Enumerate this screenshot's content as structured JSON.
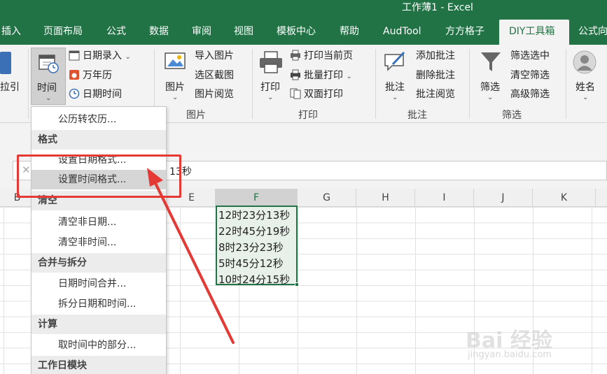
{
  "window": {
    "title": "工作薄1  -  Excel"
  },
  "tabs": [
    "插入",
    "页面布局",
    "公式",
    "数据",
    "审阅",
    "视图",
    "模板中心",
    "帮助",
    "AudTool",
    "方方格子",
    "DIY工具箱",
    "公式向"
  ],
  "ribbon": {
    "left_partial": "拉引",
    "time_button": "时间",
    "date_items": [
      "日期录入",
      "万年历",
      "日期时间"
    ],
    "picture_button": "图片",
    "picture_items": [
      "导入图片",
      "选区截图",
      "图片阅览"
    ],
    "picture_group": "图片",
    "print_button": "打印",
    "print_items": [
      "打印当前页",
      "批量打印",
      "双面打印"
    ],
    "print_group": "打印",
    "comment_button": "批注",
    "comment_items": [
      "添加批注",
      "删除批注",
      "批注阅览"
    ],
    "comment_group": "批注",
    "filter_button": "筛选",
    "filter_items": [
      "筛选选中",
      "清空筛选",
      "高级筛选"
    ],
    "filter_group": "筛选",
    "name_button": "姓名"
  },
  "menu": {
    "items": [
      {
        "type": "item",
        "label": "公历转农历..."
      },
      {
        "type": "header",
        "label": "格式"
      },
      {
        "type": "item",
        "label": "设置日期格式..."
      },
      {
        "type": "item",
        "label": "设置时间格式...",
        "highlighted": true
      },
      {
        "type": "header",
        "label": "清空"
      },
      {
        "type": "item",
        "label": "清空非日期..."
      },
      {
        "type": "item",
        "label": "清空非时间..."
      },
      {
        "type": "header",
        "label": "合并与拆分"
      },
      {
        "type": "item",
        "label": "日期时间合并..."
      },
      {
        "type": "item",
        "label": "拆分日期和时间..."
      },
      {
        "type": "header",
        "label": "计算"
      },
      {
        "type": "item",
        "label": "取时间中的部分..."
      },
      {
        "type": "header",
        "label": "工作日模块"
      }
    ]
  },
  "formula_bar": {
    "value_partial": "13秒"
  },
  "columns": [
    "B",
    "E",
    "F",
    "G",
    "H",
    "I",
    "J",
    "K"
  ],
  "selected_column": "F",
  "cells": [
    "12时23分13秒",
    "22时45分19秒",
    "8时23分23秒",
    "5时45分12秒",
    "10时24分15秒"
  ],
  "watermark": {
    "brand": "Bai 经验",
    "url": "jingyan.baidu.com"
  },
  "colors": {
    "excel_green": "#217346",
    "highlight_red": "#e53935"
  }
}
